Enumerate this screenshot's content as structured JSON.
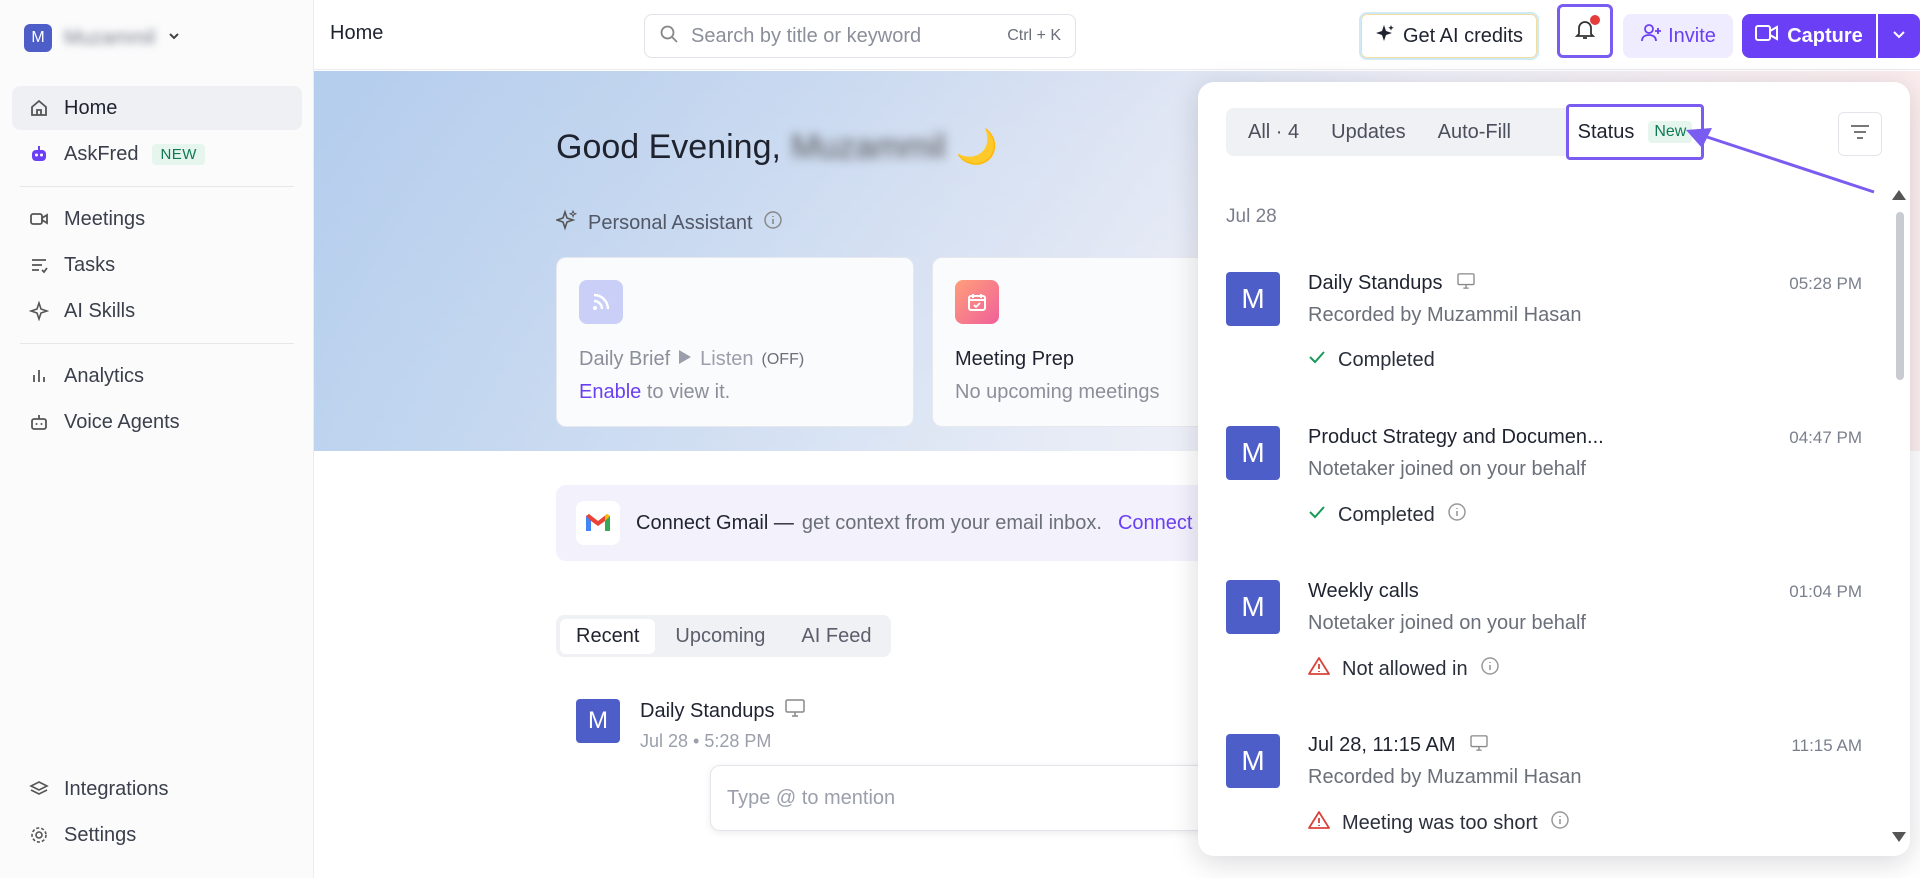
{
  "workspace": {
    "avatar": "M",
    "name": "Muzammil"
  },
  "sidebar": {
    "items": [
      {
        "label": "Home",
        "icon": "home-icon",
        "active": true
      },
      {
        "label": "AskFred",
        "icon": "robot-icon",
        "badge": "NEW"
      },
      {
        "label": "Meetings",
        "icon": "video-icon"
      },
      {
        "label": "Tasks",
        "icon": "tasks-icon"
      },
      {
        "label": "AI Skills",
        "icon": "sparkle-icon"
      },
      {
        "label": "Analytics",
        "icon": "bar-chart-icon"
      },
      {
        "label": "Voice Agents",
        "icon": "bot-icon"
      }
    ],
    "bottom": [
      {
        "label": "Integrations",
        "icon": "layers-icon"
      },
      {
        "label": "Settings",
        "icon": "gear-icon"
      }
    ]
  },
  "header": {
    "title": "Home",
    "search_placeholder": "Search by title or keyword",
    "search_shortcut": "Ctrl + K",
    "credits_label": "Get AI credits",
    "invite_label": "Invite",
    "capture_label": "Capture"
  },
  "main": {
    "greeting": "Good Evening,",
    "greeting_name": "Muzammil",
    "greeting_emoji": "🌙",
    "assistant_label": "Personal Assistant",
    "cards": [
      {
        "title": "Daily Brief",
        "listen": "Listen",
        "off": "(OFF)",
        "enable": "Enable",
        "sub_rest": "to view it."
      },
      {
        "title": "Meeting Prep",
        "sub": "No upcoming meetings"
      }
    ],
    "gmail": {
      "title": "Connect Gmail —",
      "desc": "get context from your email inbox.",
      "connect": "Connect"
    },
    "tabs": [
      "Recent",
      "Upcoming",
      "AI Feed"
    ],
    "recent": {
      "avatar": "M",
      "title": "Daily Standups",
      "meta": "Jul 28 • 5:28 PM"
    },
    "mention_placeholder": "Type @ to mention"
  },
  "notifications": {
    "tabs": {
      "all": "All · 4",
      "updates": "Updates",
      "autofill": "Auto-Fill",
      "status": "Status",
      "status_badge": "New"
    },
    "date": "Jul 28",
    "items": [
      {
        "avatar": "M",
        "title": "Daily Standups",
        "time": "05:28 PM",
        "sub": "Recorded by Muzammil Hasan",
        "status": "Completed",
        "kind": "ok",
        "info": false,
        "screen": true
      },
      {
        "avatar": "M",
        "title": "Product Strategy and Documen...",
        "time": "04:47 PM",
        "sub": "Notetaker joined on your behalf",
        "status": "Completed",
        "kind": "ok",
        "info": true,
        "screen": false
      },
      {
        "avatar": "M",
        "title": "Weekly calls",
        "time": "01:04 PM",
        "sub": "Notetaker joined on your behalf",
        "status": "Not allowed in",
        "kind": "warn",
        "info": true,
        "screen": false
      },
      {
        "avatar": "M",
        "title": "Jul 28, 11:15 AM",
        "time": "11:15 AM",
        "sub": "Recorded by Muzammil Hasan",
        "status": "Meeting was too short",
        "kind": "warn",
        "info": true,
        "screen": true
      }
    ]
  },
  "colors": {
    "accent": "#6b3ff5",
    "highlight": "#7b5cf0",
    "avatar": "#4e5ec9",
    "success": "#1a9a5a",
    "warning": "#d9433a"
  }
}
